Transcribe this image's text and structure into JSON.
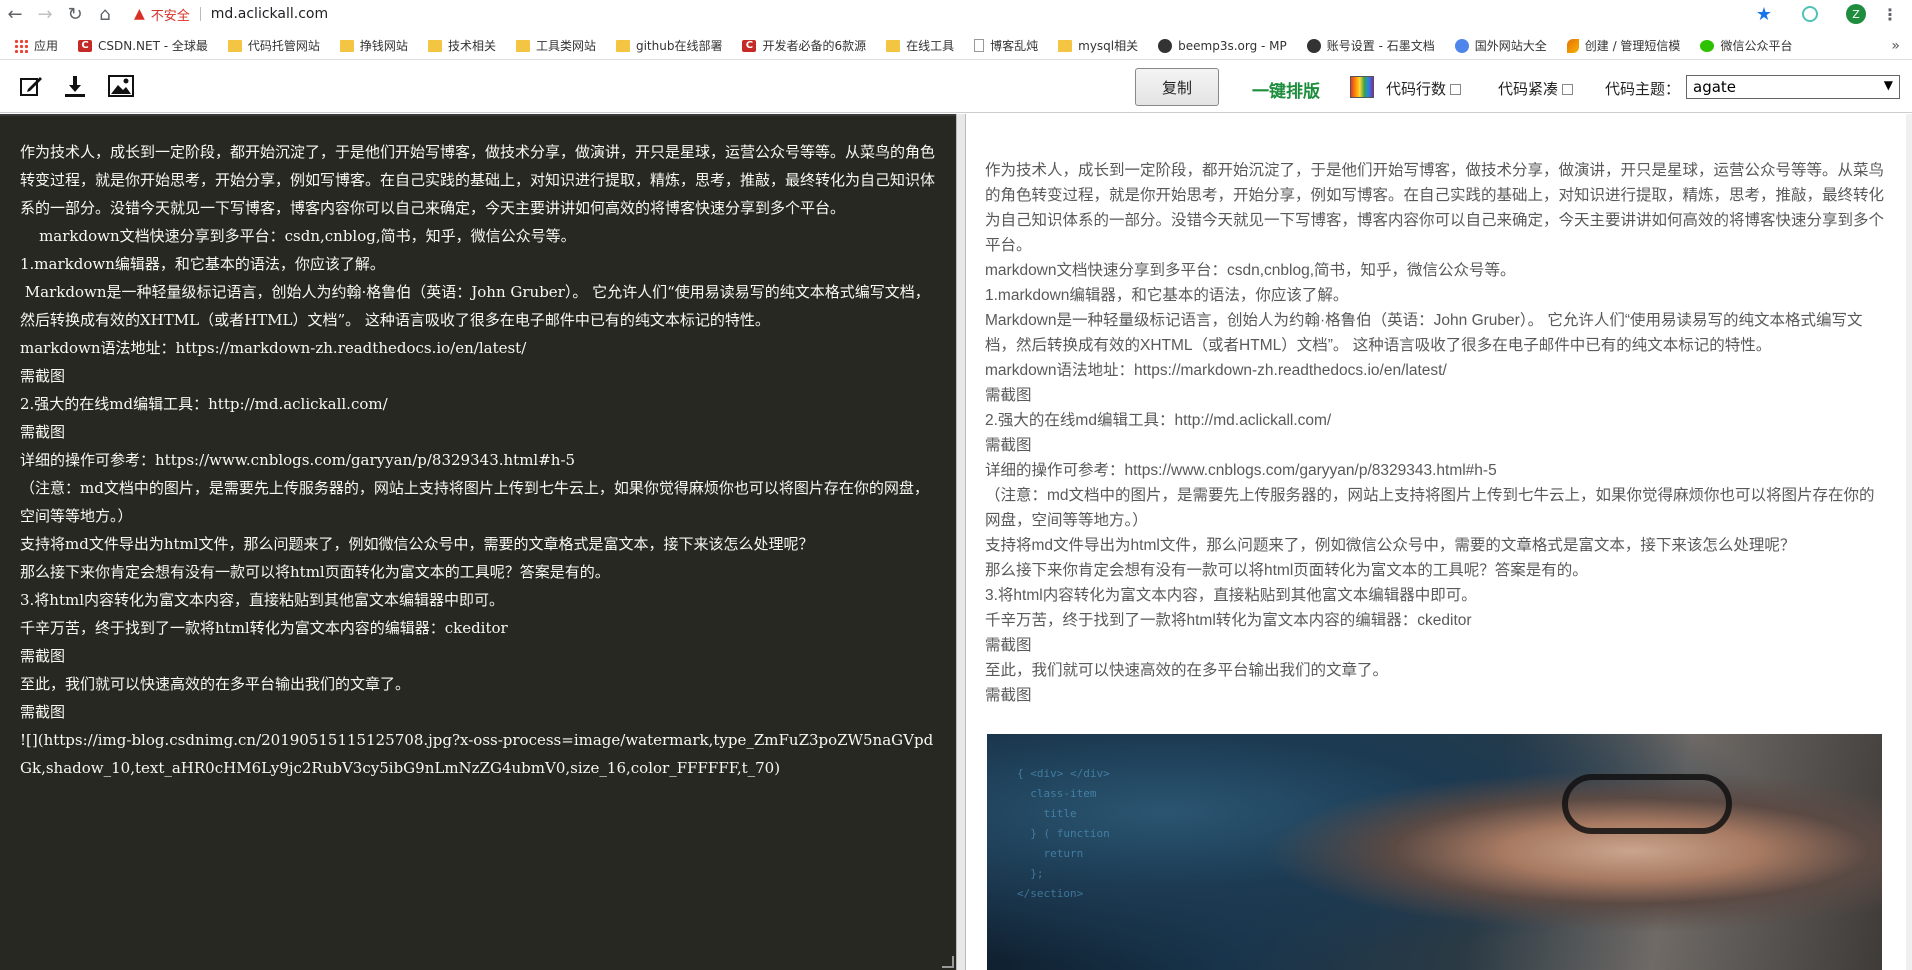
{
  "browser": {
    "insecure_label": "不安全",
    "url": "md.aclickall.com",
    "profile_initial": "Z",
    "bookmarks": [
      {
        "label": "应用",
        "icon": "apps-icon"
      },
      {
        "label": "CSDN.NET - 全球最",
        "icon": "csdn-icon"
      },
      {
        "label": "代码托管网站",
        "icon": "folder-icon"
      },
      {
        "label": "挣钱网站",
        "icon": "folder-icon"
      },
      {
        "label": "技术相关",
        "icon": "folder-icon"
      },
      {
        "label": "工具类网站",
        "icon": "folder-icon"
      },
      {
        "label": "github在线部署",
        "icon": "folder-icon"
      },
      {
        "label": "开发者必备的6款源",
        "icon": "csdn-icon"
      },
      {
        "label": "在线工具",
        "icon": "folder-icon"
      },
      {
        "label": "博客乱炖",
        "icon": "page-icon"
      },
      {
        "label": "mysql相关",
        "icon": "folder-icon"
      },
      {
        "label": "beemp3s.org - MP",
        "icon": "site-icon"
      },
      {
        "label": "账号设置 - 石墨文档",
        "icon": "shimo-icon"
      },
      {
        "label": "国外网站大全",
        "icon": "globe-icon"
      },
      {
        "label": "创建 / 管理短信模",
        "icon": "feather-icon"
      },
      {
        "label": "微信公众平台",
        "icon": "wechat-icon"
      }
    ]
  },
  "toolbar": {
    "copy_label": "复制",
    "typeset_label": "一键排版",
    "line_numbers_label": "代码行数",
    "compact_label": "代码紧凑",
    "theme_label": "代码主题：",
    "theme_value": "agate"
  },
  "editor": {
    "lines": [
      "作为技术人，成长到一定阶段，都开始沉淀了，于是他们开始写博客，做技术分享，做演讲，开只是星球，运营公众号等等。从菜鸟的角色转变过程，就是你开始思考，开始分享，例如写博客。在自己实践的基础上，对知识进行提取，精炼，思考，推敲，最终转化为自己知识体系的一部分。没错今天就见一下写博客，博客内容你可以自己来确定，今天主要讲讲如何高效的将博客快速分享到多个平台。",
      "    markdown文档快速分享到多平台：csdn,cnblog,简书，知乎，微信公众号等。",
      "1.markdown编辑器，和它基本的语法，你应该了解。",
      " Markdown是一种轻量级标记语言，创始人为约翰·格鲁伯（英语：John Gruber）。 它允许人们“使用易读易写的纯文本格式编写文档，然后转换成有效的XHTML（或者HTML）文档”。 这种语言吸收了很多在电子邮件中已有的纯文本标记的特性。",
      "markdown语法地址：https://markdown-zh.readthedocs.io/en/latest/",
      "需截图",
      "2.强大的在线md编辑工具：http://md.aclickall.com/",
      "需截图",
      "详细的操作可参考：https://www.cnblogs.com/garyyan/p/8329343.html#h-5",
      "（注意：md文档中的图片，是需要先上传服务器的，网站上支持将图片上传到七牛云上，如果你觉得麻烦你也可以将图片存在你的网盘，空间等等地方。）",
      "支持将md文件导出为html文件，那么问题来了，例如微信公众号中，需要的文章格式是富文本，接下来该怎么处理呢？",
      "那么接下来你肯定会想有没有一款可以将html页面转化为富文本的工具呢？答案是有的。",
      "3.将html内容转化为富文本内容，直接粘贴到其他富文本编辑器中即可。",
      "千辛万苦，终于找到了一款将html转化为富文本内容的编辑器：ckeditor",
      "需截图",
      "至此，我们就可以快速高效的在多平台输出我们的文章了。",
      "需截图",
      "![](https://img-blog.csdnimg.cn/20190515115125708.jpg?x-oss-process=image/watermark,type_ZmFuZ3poZW5naGVpdGk,shadow_10,text_aHR0cHM6Ly9jc2RubV3cy5ibG9nLmNzZG4ubmV0,size_16,color_FFFFFF,t_70)"
    ]
  },
  "preview": {
    "lines": [
      "作为技术人，成长到一定阶段，都开始沉淀了，于是他们开始写博客，做技术分享，做演讲，开只是星球，运营公众号等等。从菜鸟的角色转变过程，就是你开始思考，开始分享，例如写博客。在自己实践的基础上，对知识进行提取，精炼，思考，推敲，最终转化为自己知识体系的一部分。没错今天就见一下写博客，博客内容你可以自己来确定，今天主要讲讲如何高效的将博客快速分享到多个平台。",
      "markdown文档快速分享到多平台：csdn,cnblog,简书，知乎，微信公众号等。",
      "1.markdown编辑器，和它基本的语法，你应该了解。",
      "Markdown是一种轻量级标记语言，创始人为约翰·格鲁伯（英语：John Gruber）。 它允许人们“使用易读易写的纯文本格式编写文档，然后转换成有效的XHTML（或者HTML）文档”。 这种语言吸收了很多在电子邮件中已有的纯文本标记的特性。",
      "markdown语法地址：https://markdown-zh.readthedocs.io/en/latest/",
      "需截图",
      "2.强大的在线md编辑工具：http://md.aclickall.com/",
      "需截图",
      "详细的操作可参考：https://www.cnblogs.com/garyyan/p/8329343.html#h-5",
      "（注意：md文档中的图片，是需要先上传服务器的，网站上支持将图片上传到七牛云上，如果你觉得麻烦你也可以将图片存在你的网盘，空间等等地方。）",
      "支持将md文件导出为html文件，那么问题来了，例如微信公众号中，需要的文章格式是富文本，接下来该怎么处理呢？",
      "那么接下来你肯定会想有没有一款可以将html页面转化为富文本的工具呢？答案是有的。",
      "3.将html内容转化为富文本内容，直接粘贴到其他富文本编辑器中即可。",
      "千辛万苦，终于找到了一款将html转化为富文本内容的编辑器：ckeditor",
      "需截图",
      "至此，我们就可以快速高效的在多平台输出我们的文章了。",
      "需截图"
    ]
  }
}
